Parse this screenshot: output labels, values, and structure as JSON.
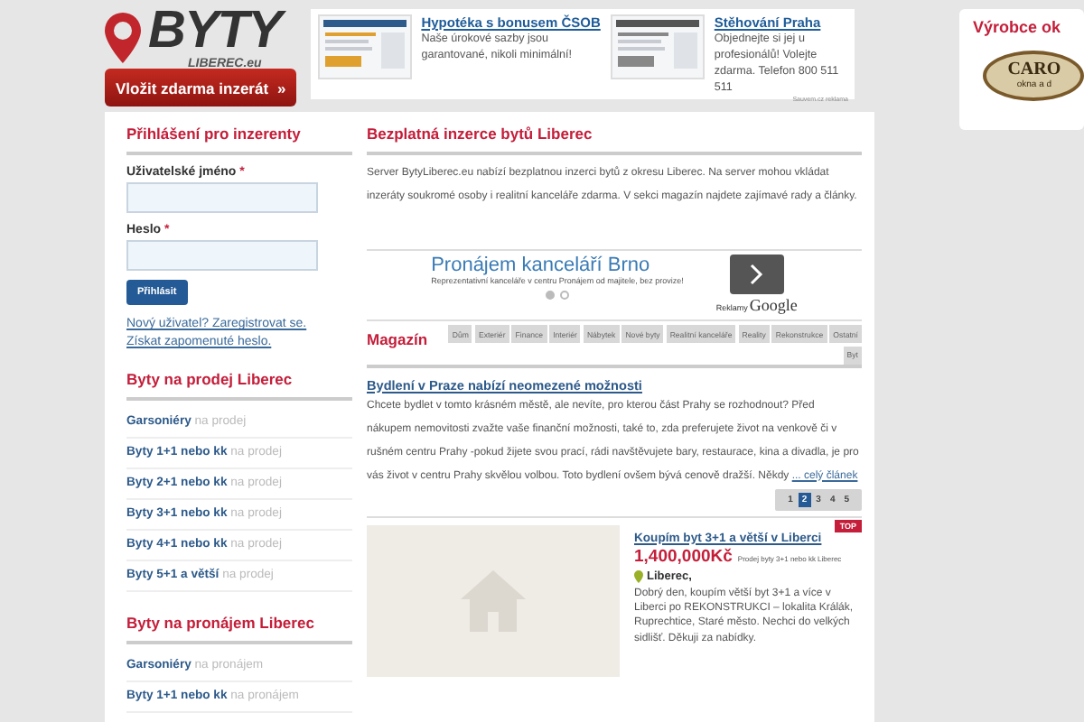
{
  "header": {
    "logo": {
      "main": "BYTY",
      "sub": "LIBEREC.eu"
    },
    "cta_button": "Vložit zdarma inzerát",
    "cta_arrows": "»",
    "ads": [
      {
        "title": "Hypotéka s bonusem ČSOB",
        "text": "Naše úrokové sazby jsou garantované, nikoli minimální!"
      },
      {
        "title": "Stěhování Praha",
        "text": "Objednejte si jej u profesionálů! Volejte zdarma. Telefon 800 511 511"
      }
    ],
    "ads_label": "Sauvem.cz reklama",
    "side_ad": {
      "title": "Výrobce ok",
      "logo": "CARO",
      "logo_sub": "okna a d"
    }
  },
  "login": {
    "title": "Přihlášení pro inzerenty",
    "username_label": "Uživatelské jméno",
    "password_label": "Heslo",
    "required": "*",
    "submit": "Přihlásit",
    "links": [
      "Nový uživatel? Zaregistrovat se.",
      "Získat zapomenuté heslo."
    ]
  },
  "sale": {
    "title": "Byty na prodej Liberec",
    "items": [
      {
        "name": "Garsoniéry",
        "suffix": "na prodej"
      },
      {
        "name": "Byty 1+1 nebo kk",
        "suffix": "na prodej"
      },
      {
        "name": "Byty 2+1 nebo kk",
        "suffix": "na prodej"
      },
      {
        "name": "Byty 3+1 nebo kk",
        "suffix": "na prodej"
      },
      {
        "name": "Byty 4+1 nebo kk",
        "suffix": "na prodej"
      },
      {
        "name": "Byty 5+1 a větší",
        "suffix": "na prodej"
      }
    ]
  },
  "rent": {
    "title": "Byty na pronájem Liberec",
    "items": [
      {
        "name": "Garsoniéry",
        "suffix": "na pronájem"
      },
      {
        "name": "Byty 1+1 nebo kk",
        "suffix": "na pronájem"
      }
    ]
  },
  "intro": {
    "title": "Bezplatná inzerce bytů Liberec",
    "text": "Server BytyLiberec.eu nabízí bezplatnou inzerci bytů z okresu Liberec. Na server mohou vkládat inzeráty soukromé osoby i realitní kanceláře zdarma. V sekci magazín najdete zajímavé rady a články."
  },
  "google_ad": {
    "title": "Pronájem kanceláří Brno",
    "text": "Reprezentativní kanceláře v centru Pronájem od majitele, bez provize!",
    "dots": [
      {
        "selected": true
      },
      {
        "selected": false
      }
    ],
    "label_small": "Reklamy",
    "label_brand": "Google"
  },
  "magazine": {
    "title": "Magazín",
    "tabs": [
      "Dům",
      "Exteriér",
      "Finance",
      "Interiér",
      "Nábytek",
      "Nové byty",
      "Realitní kanceláře",
      "Reality",
      "Rekonstrukce",
      "Ostatní",
      "Byt"
    ],
    "article": {
      "title": "Bydlení v Praze nabízí neomezené možnosti",
      "text": "Chcete bydlet v tomto krásném městě, ale nevíte, pro kterou část Prahy se rozhodnout? Před nákupem nemovitosti zvažte vaše finanční možnosti, také to, zda preferujete život na venkově či v rušném centru Prahy -pokud žijete svou prací, rádi navštěvujete bary, restaurace, kina a divadla, je pro vás život v centru Prahy skvělou volbou. Toto bydlení ovšem bývá cenově dražší. Někdy",
      "more": "... celý článek"
    },
    "pages": [
      {
        "label": "1",
        "selected": false
      },
      {
        "label": "2",
        "selected": true
      },
      {
        "label": "3",
        "selected": false
      },
      {
        "label": "4",
        "selected": false
      },
      {
        "label": "5",
        "selected": false
      }
    ]
  },
  "listing": {
    "badge": "TOP",
    "title": "Koupím byt 3+1 a větší v Liberci",
    "price": "1,400,000Kč",
    "category": "Prodej byty 3+1 nebo kk Liberec",
    "location": "Liberec,",
    "text": "Dobrý den, koupím větší byt 3+1 a více v Liberci po REKONSTRUKCI – lokalita Králák, Ruprechtice, Staré město. Nechci do velkých sidlišť. Děkuji za nabídky."
  }
}
